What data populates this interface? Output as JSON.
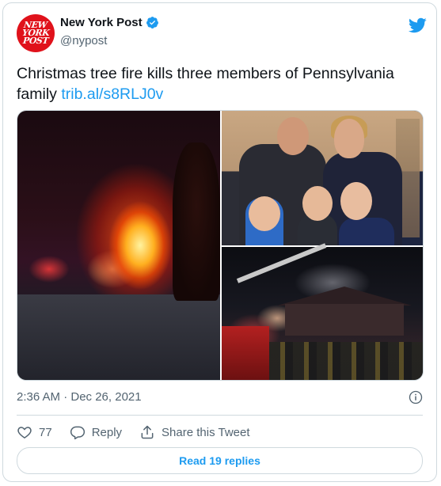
{
  "author": {
    "name": "New York Post",
    "handle": "@nypost",
    "avatar_text": [
      "NEW",
      "YORK",
      "POST"
    ],
    "verified": true,
    "avatar_color": "#e0121b"
  },
  "tweet": {
    "text": "Christmas tree fire kills three members of Pennsylvania family ",
    "link": "trib.al/s8RLJ0v",
    "timestamp": "2:36 AM · Dec 26, 2021",
    "media": [
      {
        "name": "fire-photo"
      },
      {
        "name": "family-photo"
      },
      {
        "name": "firefighters-photo"
      }
    ]
  },
  "actions": {
    "like_count": "77",
    "reply_label": "Reply",
    "share_label": "Share this Tweet"
  },
  "replies_button": "Read 19 replies",
  "colors": {
    "accent": "#1d9bf0",
    "secondary_text": "#536471",
    "border": "#cfd9de"
  },
  "icons": [
    "twitter-bird-icon",
    "verified-badge-icon",
    "info-icon",
    "heart-icon",
    "reply-icon",
    "share-icon"
  ]
}
